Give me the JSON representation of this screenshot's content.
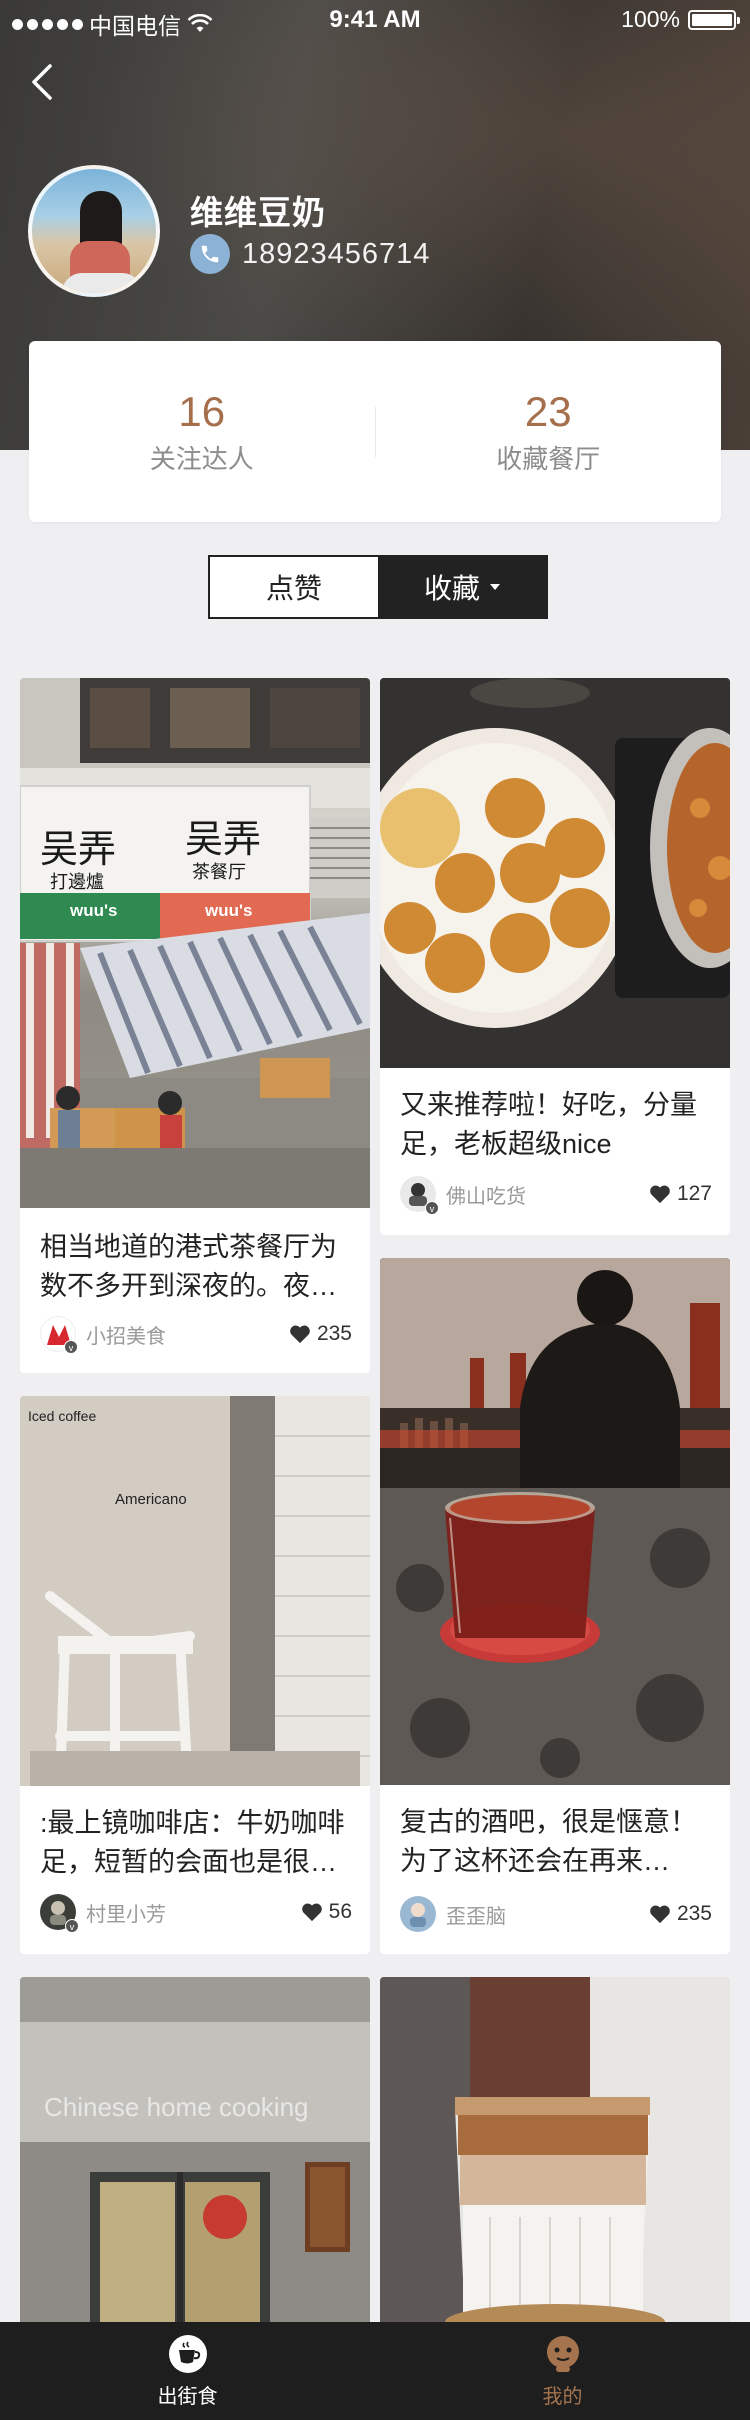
{
  "status_bar": {
    "carrier": "中国电信",
    "time": "9:41 AM",
    "battery": "100%"
  },
  "profile": {
    "name": "维维豆奶",
    "phone": "18923456714"
  },
  "stats": [
    {
      "value": "16",
      "label": "关注达人"
    },
    {
      "value": "23",
      "label": "收藏餐厅"
    }
  ],
  "segment": {
    "like_label": "点赞",
    "fav_label": "收藏"
  },
  "cards": [
    {
      "title": "相当地道的港式茶餐厅为数不多开到深夜的。夜…",
      "author": "小招美食",
      "likes": "235"
    },
    {
      "title": "又来推荐啦！好吃，分量足，老板超级nice",
      "author": "佛山吃货",
      "likes": "127"
    },
    {
      "title": ":最上镜咖啡店：牛奶咖啡足，短暂的会面也是很…",
      "author": "村里小芳",
      "likes": "56"
    },
    {
      "title": "复古的酒吧，很是惬意！为了这杯还会在再来…",
      "author": "歪歪脑",
      "likes": "235"
    }
  ],
  "photo_text": {
    "shop_sign_1": "吴弄",
    "shop_sign_1_sub": "打邊爐",
    "shop_sign_2": "吴弄",
    "shop_sign_2_sub": "茶餐厅",
    "shop_brand": "wuu's",
    "coffee_menu_1": "Iced coffee",
    "coffee_menu_2": "Americano",
    "cooking_sign": "Chinese home cooking"
  },
  "tabbar": [
    {
      "label": "出街食"
    },
    {
      "label": "我的"
    }
  ],
  "colors": {
    "accent": "#a56f4c",
    "dark": "#222222",
    "tabbar": "#1e1e1e"
  }
}
